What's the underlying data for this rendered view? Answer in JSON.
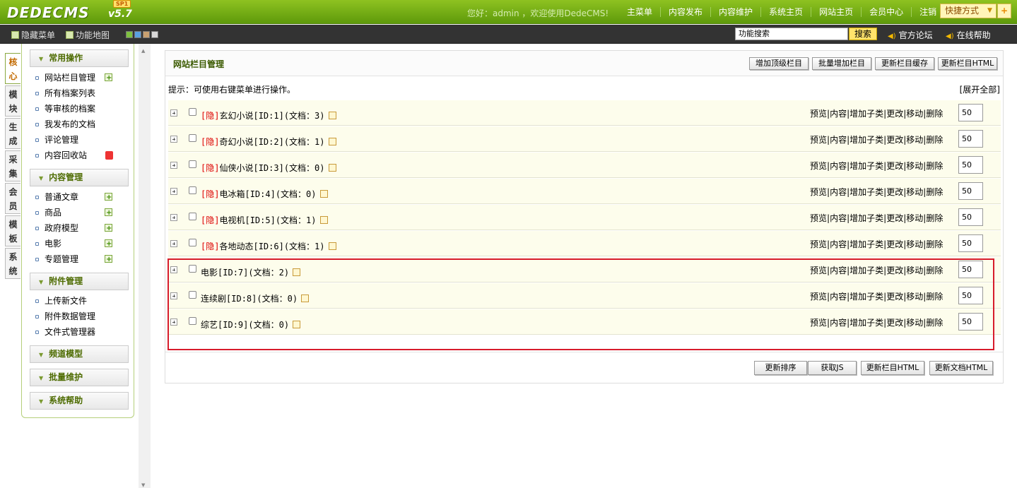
{
  "header": {
    "logo": "DEDECMS",
    "version": "v5.7",
    "badge": "SP1",
    "welcome": "您好：admin ，欢迎使用DedeCMS!",
    "nav": [
      "主菜单",
      "内容发布",
      "内容维护",
      "系统主页",
      "网站主页",
      "会员中心",
      "注销"
    ],
    "quick_label": "快捷方式",
    "quick_plus": "+"
  },
  "subbar": {
    "hide_menu": "隐藏菜单",
    "func_map": "功能地图",
    "swatch_colors": [
      "#7fc140",
      "#5aa0e0",
      "#c8a070",
      "#d8d8d8"
    ],
    "search_value": "功能搜索",
    "search_button": "搜索",
    "forum": "官方论坛",
    "help": "在线帮助"
  },
  "vtabs": [
    "核心",
    "模块",
    "生成",
    "采集",
    "会员",
    "模板",
    "系统"
  ],
  "sidebar": {
    "groups": [
      {
        "title": "常用操作",
        "items": [
          {
            "label": "网站栏目管理",
            "action": "add"
          },
          {
            "label": "所有档案列表",
            "action": ""
          },
          {
            "label": "等审核的档案",
            "action": ""
          },
          {
            "label": "我发布的文档",
            "action": ""
          },
          {
            "label": "评论管理",
            "action": ""
          },
          {
            "label": "内容回收站",
            "action": "trash"
          }
        ]
      },
      {
        "title": "内容管理",
        "items": [
          {
            "label": "普通文章",
            "action": "add"
          },
          {
            "label": "商品",
            "action": "add"
          },
          {
            "label": "政府模型",
            "action": "add"
          },
          {
            "label": "电影",
            "action": "add"
          },
          {
            "label": "专题管理",
            "action": "add"
          }
        ]
      },
      {
        "title": "附件管理",
        "items": [
          {
            "label": "上传新文件",
            "action": ""
          },
          {
            "label": "附件数据管理",
            "action": ""
          },
          {
            "label": "文件式管理器",
            "action": ""
          }
        ]
      },
      {
        "title": "频道模型",
        "items": []
      },
      {
        "title": "批量维护",
        "items": []
      },
      {
        "title": "系统帮助",
        "items": []
      }
    ]
  },
  "main": {
    "title": "网站栏目管理",
    "header_buttons": [
      "增加顶级栏目",
      "批量增加栏目",
      "更新栏目缓存",
      "更新栏目HTML"
    ],
    "tip": "提示：可使用右键菜单进行操作。",
    "expand_all": "[展开全部]",
    "hidden_tag": "[隐]",
    "ops": [
      "预览",
      "内容",
      "增加子类",
      "更改",
      "移动",
      "删除"
    ],
    "rows": [
      {
        "hidden": true,
        "name": "玄幻小说",
        "id": "[ID:1]",
        "docs": "(文档：3)",
        "order": "50"
      },
      {
        "hidden": true,
        "name": "奇幻小说",
        "id": "[ID:2]",
        "docs": "(文档：1)",
        "order": "50"
      },
      {
        "hidden": true,
        "name": "仙侠小说",
        "id": "[ID:3]",
        "docs": "(文档：0)",
        "order": "50"
      },
      {
        "hidden": true,
        "name": "电冰箱",
        "id": "[ID:4]",
        "docs": "(文档：0)",
        "order": "50"
      },
      {
        "hidden": true,
        "name": "电视机",
        "id": "[ID:5]",
        "docs": "(文档：1)",
        "order": "50"
      },
      {
        "hidden": true,
        "name": "各地动态",
        "id": "[ID:6]",
        "docs": "(文档：1)",
        "order": "50"
      },
      {
        "hidden": false,
        "name": "电影",
        "id": "[ID:7]",
        "docs": "(文档：2)",
        "order": "50"
      },
      {
        "hidden": false,
        "name": "连续剧",
        "id": "[ID:8]",
        "docs": "(文档：0)",
        "order": "50"
      },
      {
        "hidden": false,
        "name": "综艺",
        "id": "[ID:9]",
        "docs": "(文档：0)",
        "order": "50"
      }
    ],
    "footer_buttons": [
      "更新排序",
      "获取JS",
      "更新栏目HTML",
      "更新文档HTML"
    ]
  }
}
